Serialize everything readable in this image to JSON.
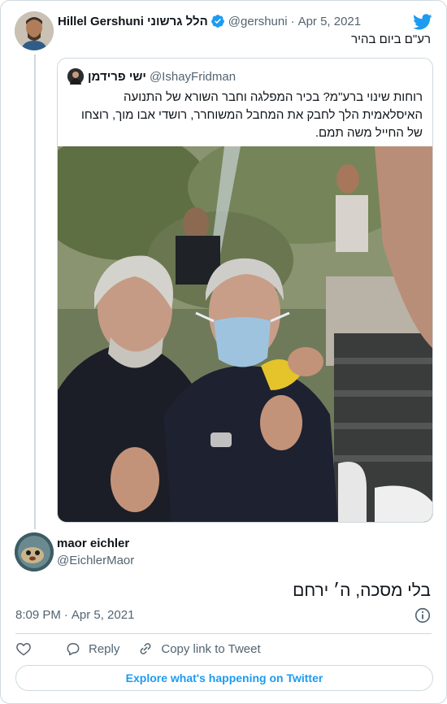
{
  "tweet": {
    "author_name": "Hillel Gershuni הלל גרשוני",
    "author_handle": "@gershuni",
    "date": "Apr 5, 2021",
    "text": "רע\"ם ביום בהיר",
    "verified": true
  },
  "quoted": {
    "author_name": "ישי פרידמן",
    "author_handle": "@IshayFridman",
    "text": "רוחות שינוי ברע\"מ? בכיר המפלגה וחבר השורא של התנועה האיסלאמית הלך לחבק את המחבל המשוחרר, רושדי אבו מוך, רוצחו של החייל משה תמם."
  },
  "reply": {
    "author_name": "maor eichler",
    "author_handle": "@EichlerMaor",
    "text": "בלי מסכה, ה׳ ירחם"
  },
  "meta": {
    "time": "8:09 PM",
    "date": "Apr 5, 2021"
  },
  "actions": {
    "reply_label": "Reply",
    "copy_link_label": "Copy link to Tweet"
  },
  "explore_label": "Explore what's happening on Twitter",
  "colors": {
    "brand": "#1d9bf0",
    "text": "#0f1419",
    "muted": "#536471",
    "border": "#cfd9de"
  },
  "icons": {
    "verified": "verified-badge-icon",
    "logo": "twitter-bird-icon",
    "info": "info-icon",
    "like": "heart-icon",
    "reply": "reply-bubble-icon",
    "copy": "link-icon"
  }
}
